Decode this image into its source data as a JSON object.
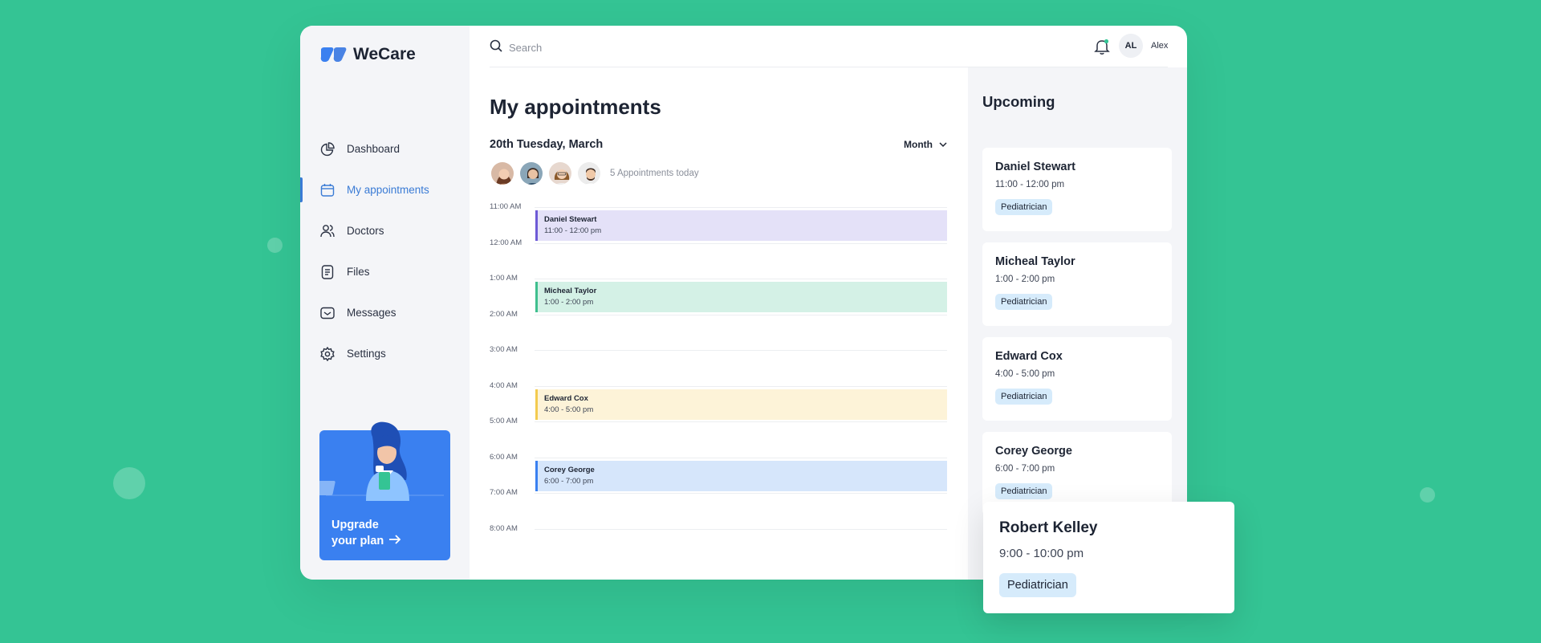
{
  "app": {
    "name": "WeCare"
  },
  "sidebar": {
    "items": [
      {
        "label": "Dashboard",
        "icon": "chart-pie-icon",
        "active": false
      },
      {
        "label": "My appointments",
        "icon": "calendar-icon",
        "active": true
      },
      {
        "label": "Doctors",
        "icon": "users-icon",
        "active": false
      },
      {
        "label": "Files",
        "icon": "file-icon",
        "active": false
      },
      {
        "label": "Messages",
        "icon": "inbox-icon",
        "active": false
      },
      {
        "label": "Settings",
        "icon": "gear-icon",
        "active": false
      }
    ],
    "upgrade": {
      "line1": "Upgrade",
      "line2": "your plan"
    }
  },
  "header": {
    "search_placeholder": "Search",
    "user_initials": "AL",
    "user_name": "Alex"
  },
  "main": {
    "title": "My appointments",
    "date": "20th Tuesday, March",
    "view": "Month",
    "appointments_today": "5 Appointments today",
    "times": [
      "11:00 AM",
      "12:00 AM",
      "1:00 AM",
      "2:00 AM",
      "3:00 AM",
      "4:00 AM",
      "5:00 AM",
      "6:00 AM",
      "7:00 AM",
      "8:00 AM"
    ],
    "events": [
      {
        "name": "Daniel Stewart",
        "time": "11:00 - 12:00 pm",
        "color": "#e4e1f8",
        "accent": "#6d5ad6"
      },
      {
        "name": "Micheal Taylor",
        "time": "1:00 - 2:00 pm",
        "color": "#d4f1e6",
        "accent": "#3fbf8e"
      },
      {
        "name": "Edward Cox",
        "time": "4:00 - 5:00 pm",
        "color": "#fdf3d8",
        "accent": "#f3cb4f"
      },
      {
        "name": "Corey George",
        "time": "6:00 - 7:00 pm",
        "color": "#d6e6fb",
        "accent": "#3a80f0"
      }
    ]
  },
  "upcoming": {
    "title": "Upcoming",
    "cards": [
      {
        "name": "Daniel Stewart",
        "time": "11:00 - 12:00 pm",
        "tag": "Pediatrician"
      },
      {
        "name": "Micheal Taylor",
        "time": "1:00 - 2:00 pm",
        "tag": "Pediatrician"
      },
      {
        "name": "Edward Cox",
        "time": "4:00 - 5:00 pm",
        "tag": "Pediatrician"
      },
      {
        "name": "Corey George",
        "time": "6:00 - 7:00 pm",
        "tag": "Pediatrician"
      }
    ],
    "featured": {
      "name": "Robert Kelley",
      "time": "9:00 - 10:00 pm",
      "tag": "Pediatrician"
    }
  },
  "colors": {
    "background": "#34c494",
    "accent": "#3a7bd5",
    "tag": "#d6ebfb"
  }
}
